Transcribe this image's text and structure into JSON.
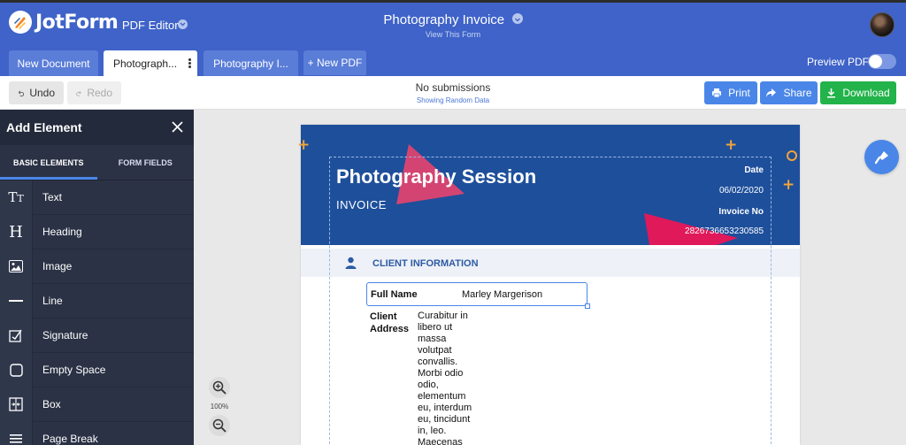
{
  "header": {
    "logo_text": "JotForm",
    "app_name": "PDF Editor",
    "form_title": "Photography Invoice",
    "form_subtitle": "View This Form"
  },
  "tabs": [
    {
      "label": "New Document",
      "active": false
    },
    {
      "label": "Photograph...",
      "active": true
    },
    {
      "label": "Photography I...",
      "active": false
    }
  ],
  "new_pdf_label": "+ New PDF",
  "preview": {
    "label": "Preview PDF",
    "enabled": false
  },
  "toolbar": {
    "undo_label": "Undo",
    "redo_label": "Redo",
    "status": "No submissions",
    "status_sub": "Showing Random Data",
    "print_label": "Print",
    "share_label": "Share",
    "download_label": "Download"
  },
  "sidebar": {
    "title": "Add Element",
    "tabs": [
      "BASIC ELEMENTS",
      "FORM FIELDS"
    ],
    "items": [
      {
        "label": "Text",
        "icon": "text-icon"
      },
      {
        "label": "Heading",
        "icon": "heading-icon"
      },
      {
        "label": "Image",
        "icon": "image-icon"
      },
      {
        "label": "Line",
        "icon": "line-icon"
      },
      {
        "label": "Signature",
        "icon": "signature-icon"
      },
      {
        "label": "Empty Space",
        "icon": "empty-space-icon"
      },
      {
        "label": "Box",
        "icon": "box-icon"
      },
      {
        "label": "Page Break",
        "icon": "page-break-icon"
      }
    ]
  },
  "zoom": {
    "level": "100%"
  },
  "document": {
    "title": "Photography Session",
    "subtitle": "INVOICE",
    "date_label": "Date",
    "date_value": "06/02/2020",
    "invoice_no_label": "Invoice No",
    "invoice_no_value": "2826736653230585",
    "section_title": "CLIENT INFORMATION",
    "full_name_label": "Full Name",
    "full_name_value": "Marley Margerison",
    "address_label": "Client Address",
    "address_value": "Curabitur in libero ut massa volutpat convallis. Morbi odio odio, elementum eu, interdum eu, tincidunt in, leo. Maecenas"
  },
  "colors": {
    "brand_blue": "#3f63c8",
    "sidebar_dark": "#2b3245",
    "doc_header": "#1e4f9b",
    "accent_pink": "#e8426e",
    "accent_orange": "#f0a53a",
    "download_green": "#22b34a"
  }
}
